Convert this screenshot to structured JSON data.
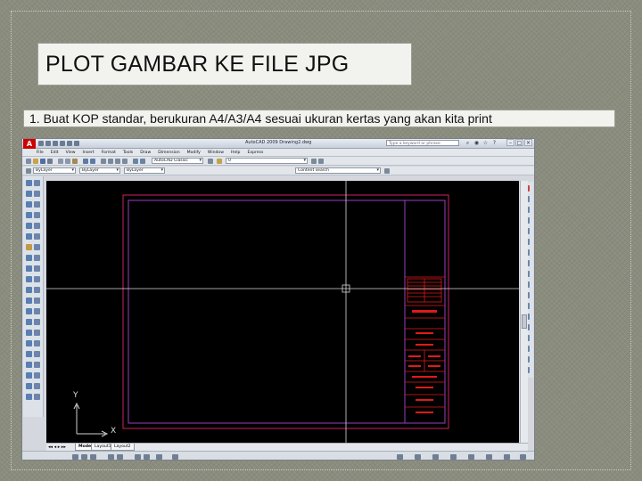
{
  "slide": {
    "title": "PLOT GAMBAR KE FILE JPG",
    "subtitle": "1. Buat KOP standar, berukuran A4/A3/A4 sesuai ukuran kertas yang akan kita print"
  },
  "autocad": {
    "app_logo": "A",
    "window_title": "AutoCAD 2009 Drawing2.dwg",
    "help_search_placeholder": "Type a keyword or phrase",
    "menu": [
      "File",
      "Edit",
      "View",
      "Insert",
      "Format",
      "Tools",
      "Draw",
      "Dimension",
      "Modify",
      "Window",
      "Help",
      "Express"
    ],
    "workspace_dropdown": "AutoCAD Classic",
    "layer_dropdown": "0",
    "style_dropdown": "ByLayer",
    "color_dropdown": "ByLayer",
    "linetype_dropdown": "ByLayer",
    "content_search_placeholder": "Content search",
    "tabs": [
      "Model",
      "Layout1",
      "Layout2"
    ],
    "active_tab": "Model",
    "ucs_x": "X",
    "ucs_y": "Y",
    "colors": {
      "viewport_bg": "#000000",
      "frame_outer": "#cc2266",
      "frame_inner": "#9a3fbf",
      "kop_red": "#e01a1a",
      "crosshair": "#d8d8d8"
    }
  }
}
